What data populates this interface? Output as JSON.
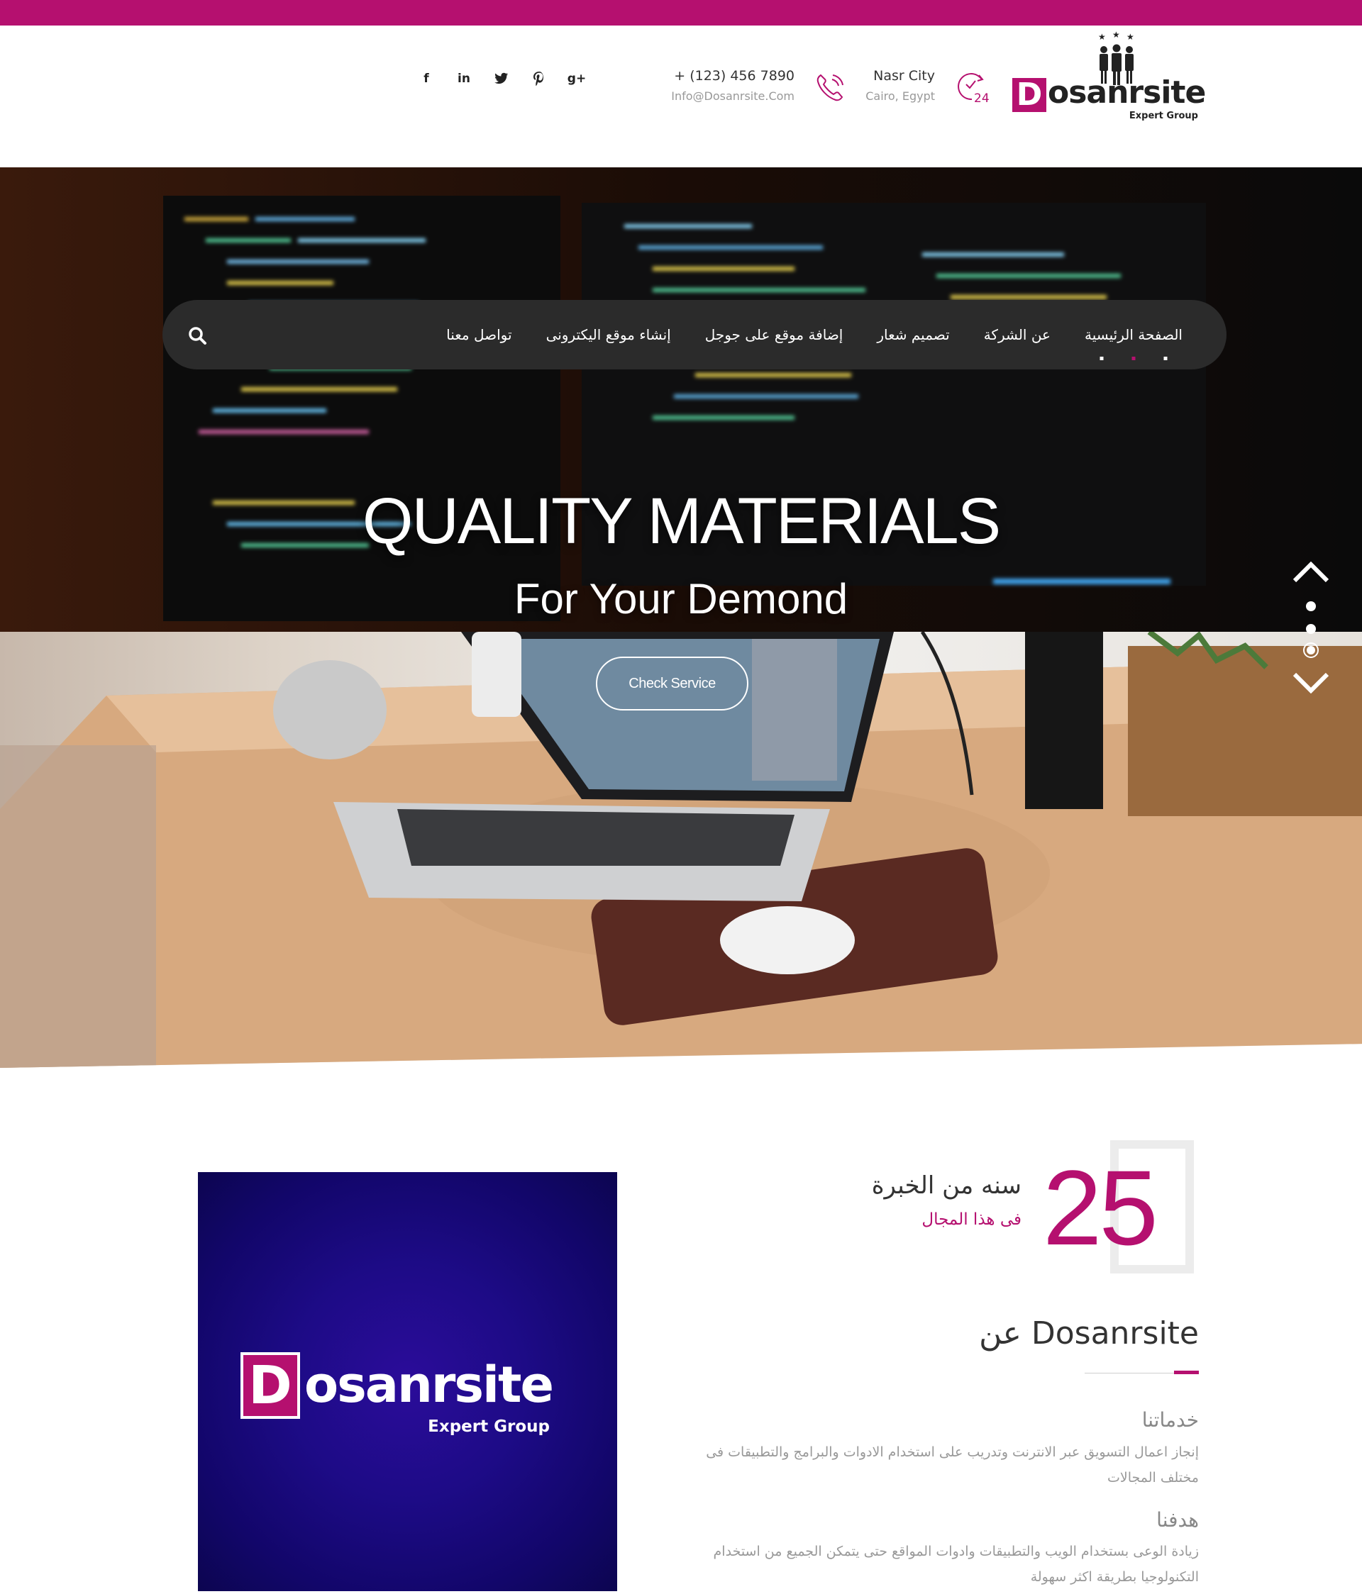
{
  "colors": {
    "accent": "#b5106f",
    "nav_bg": "#2b2b2b",
    "text_dark": "#333333",
    "text_muted": "#999999"
  },
  "header": {
    "social": [
      {
        "icon": "facebook-icon",
        "glyph": "f"
      },
      {
        "icon": "linkedin-icon",
        "glyph": "in"
      },
      {
        "icon": "twitter-icon",
        "glyph": "🐦"
      },
      {
        "icon": "pinterest-icon",
        "glyph": "P"
      },
      {
        "icon": "google-plus-icon",
        "glyph": "g+"
      }
    ],
    "phone": "+ (123) 456 7890",
    "email": "Info@Dosanrsite.Com",
    "city": "Nasr City",
    "address": "Cairo, Egypt",
    "clock_badge": "24",
    "logo": {
      "letter": "D",
      "name": "osanrsite",
      "tagline": "Expert Group"
    }
  },
  "nav": {
    "items": [
      "الصفحة الرئيسية",
      "عن الشركة",
      "تصميم شعار",
      "إضافة موقع على جوجل",
      "إنشاء موقع اليكترونى",
      "تواصل معنا"
    ],
    "active_index": 0
  },
  "hero": {
    "title": "QUALITY MATERIALS",
    "subtitle": "For Your Demond",
    "cta": "Check Service",
    "slides": 3,
    "active_slide": 2
  },
  "experience": {
    "number": "25",
    "title": "سنه من الخبرة",
    "subtitle": "فى هذا المجال"
  },
  "about": {
    "heading": "عن Dosanrsite",
    "image_logo": {
      "letter": "D",
      "name": "osanrsite",
      "tagline": "Expert Group"
    },
    "services_title": "خدماتنا",
    "services_text": "إنجاز اعمال التسويق عبر الانترنت وتدريب على استخدام الادوات والبرامج والتطبيقات فى مختلف المجالات",
    "goal_title": "هدفنا",
    "goal_text": "زيادة الوعى بستخدام الويب والتطبيقات وادوات المواقع حتى يتمكن الجميع من استخدام التكنولوجيا بطريقة اكثر سهولة"
  }
}
